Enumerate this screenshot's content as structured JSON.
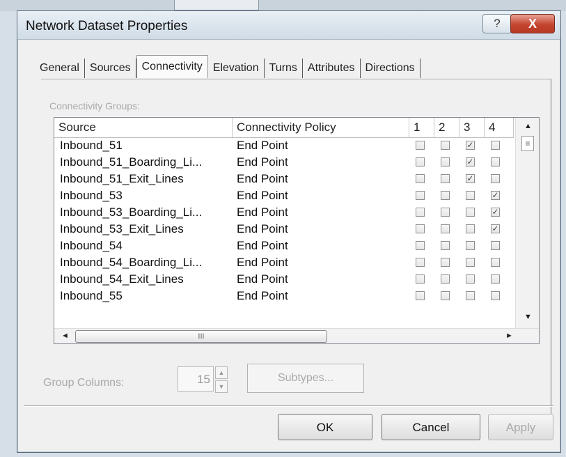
{
  "dialog": {
    "title": "Network Dataset Properties",
    "help_label": "?",
    "close_label": "X"
  },
  "tabs": [
    {
      "label": "General",
      "active": false
    },
    {
      "label": "Sources",
      "active": false
    },
    {
      "label": "Connectivity",
      "active": true
    },
    {
      "label": "Elevation",
      "active": false
    },
    {
      "label": "Turns",
      "active": false
    },
    {
      "label": "Attributes",
      "active": false
    },
    {
      "label": "Directions",
      "active": false
    }
  ],
  "connectivity": {
    "groups_label": "Connectivity Groups:",
    "columns": {
      "source": "Source",
      "policy": "Connectivity Policy",
      "groups": [
        "1",
        "2",
        "3",
        "4"
      ]
    },
    "rows": [
      {
        "source": "Inbound_51",
        "policy": "End Point",
        "checks": [
          false,
          false,
          true,
          false
        ]
      },
      {
        "source": "Inbound_51_Boarding_Li...",
        "policy": "End Point",
        "checks": [
          false,
          false,
          true,
          false
        ]
      },
      {
        "source": "Inbound_51_Exit_Lines",
        "policy": "End Point",
        "checks": [
          false,
          false,
          true,
          false
        ]
      },
      {
        "source": "Inbound_53",
        "policy": "End Point",
        "checks": [
          false,
          false,
          false,
          true
        ]
      },
      {
        "source": "Inbound_53_Boarding_Li...",
        "policy": "End Point",
        "checks": [
          false,
          false,
          false,
          true
        ]
      },
      {
        "source": "Inbound_53_Exit_Lines",
        "policy": "End Point",
        "checks": [
          false,
          false,
          false,
          true
        ]
      },
      {
        "source": "Inbound_54",
        "policy": "End Point",
        "checks": [
          false,
          false,
          false,
          false
        ]
      },
      {
        "source": "Inbound_54_Boarding_Li...",
        "policy": "End Point",
        "checks": [
          false,
          false,
          false,
          false
        ]
      },
      {
        "source": "Inbound_54_Exit_Lines",
        "policy": "End Point",
        "checks": [
          false,
          false,
          false,
          false
        ]
      },
      {
        "source": "Inbound_55",
        "policy": "End Point",
        "checks": [
          false,
          false,
          false,
          false
        ]
      }
    ],
    "vscroll_thumb_glyph": "≡",
    "hscroll_thumb_glyph": "III",
    "scroll_up_glyph": "▲",
    "scroll_down_glyph": "▼",
    "scroll_left_glyph": "◄",
    "scroll_right_glyph": "►"
  },
  "group_columns": {
    "label": "Group Columns:",
    "value": "15"
  },
  "subtypes_label": "Subtypes...",
  "buttons": {
    "ok": "OK",
    "cancel": "Cancel",
    "apply": "Apply"
  },
  "colors": {
    "close": "#c4452f",
    "titlebar": "#cfdbe6",
    "disabled_text": "#a9a9a9"
  }
}
